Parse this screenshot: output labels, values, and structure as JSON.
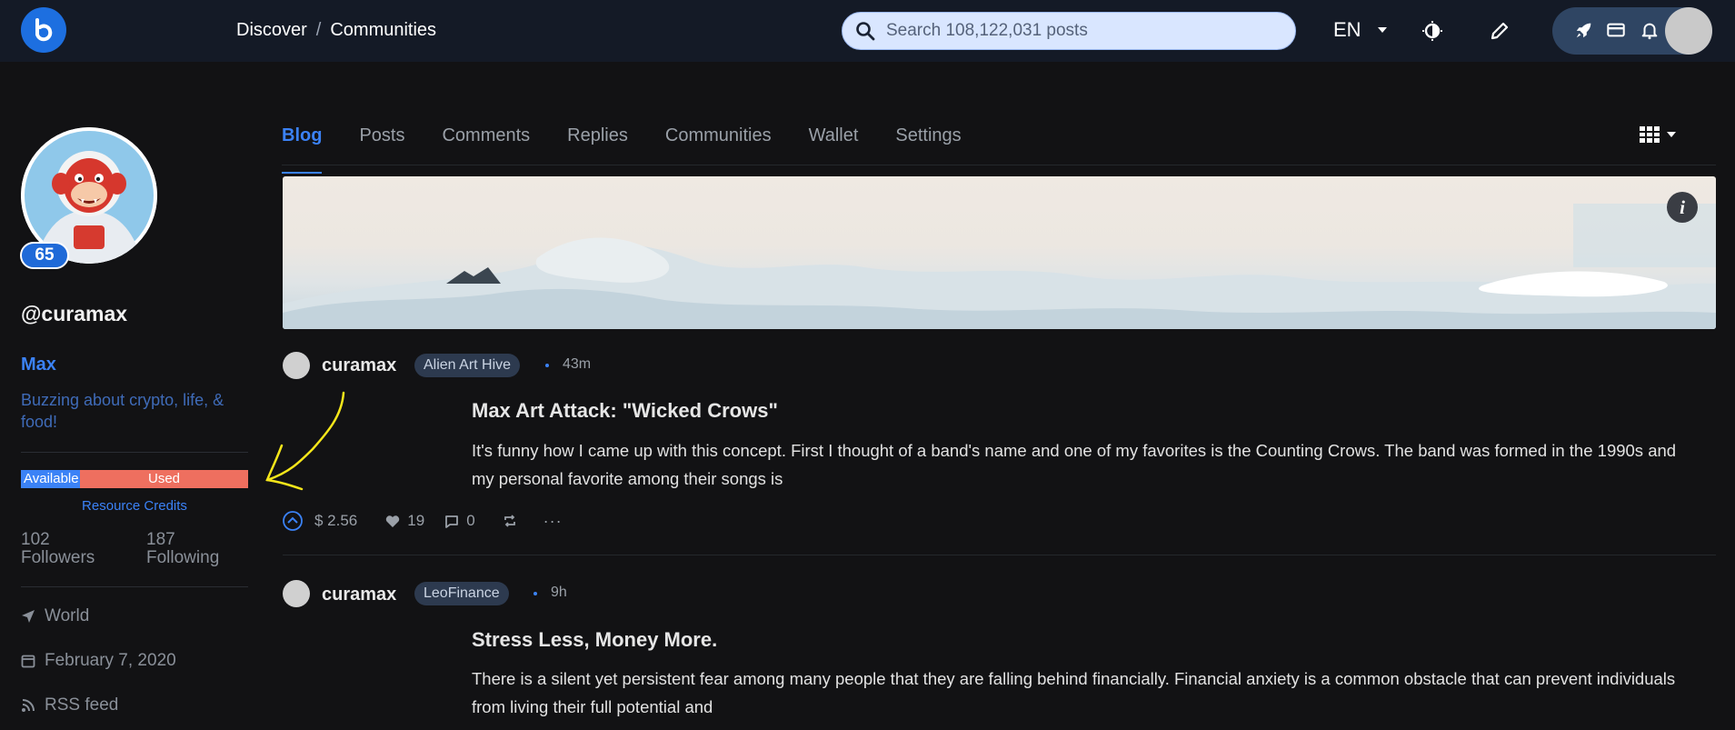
{
  "header": {
    "breadcrumb": [
      "Discover",
      "Communities"
    ],
    "search_placeholder": "Search 108,122,031 posts",
    "language": "EN"
  },
  "profile": {
    "reputation": "65",
    "handle": "@curamax",
    "display_name": "Max",
    "about": "Buzzing about crypto, life, & food!",
    "rc_available_label": "Available",
    "rc_used_label": "Used",
    "rc_available_fraction": 0.26,
    "rc_title": "Resource Credits",
    "followers_count": "102",
    "followers_label": "Followers",
    "following_count": "187",
    "following_label": "Following",
    "location": "World",
    "joined": "February 7, 2020",
    "rss": "RSS feed"
  },
  "tabs": [
    "Blog",
    "Posts",
    "Comments",
    "Replies",
    "Communities",
    "Wallet",
    "Settings"
  ],
  "active_tab": "Blog",
  "posts": [
    {
      "author": "curamax",
      "community": "Alien Art Hive",
      "time": "43m",
      "title": "Max Art Attack: \"Wicked Crows\"",
      "body": "It's funny how I came up with this concept. First I thought of a band's name and one of my favorites is the Counting Crows. The band was formed in the 1990s and my personal favorite among their songs is",
      "payout": "$ 2.56",
      "votes": "19",
      "comments": "0"
    },
    {
      "author": "curamax",
      "community": "LeoFinance",
      "time": "9h",
      "title": "Stress Less, Money More.",
      "body": "There is a silent yet persistent fear among many people that they are falling behind financially. Financial anxiety is a common obstacle that can prevent individuals from living their full potential and"
    }
  ],
  "colors": {
    "accent": "#3b82f6",
    "rc_used": "#ee6f5f",
    "topbar": "#141a26",
    "background": "#121214",
    "annotation": "#f5e61a"
  }
}
